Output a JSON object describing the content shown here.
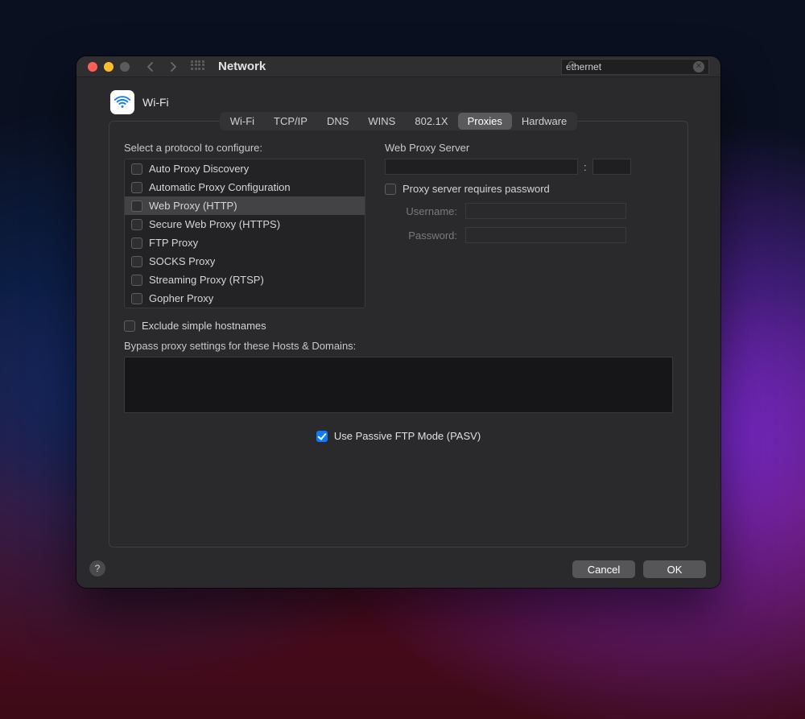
{
  "window": {
    "title": "Network",
    "search_value": "ethernet"
  },
  "interface": {
    "name": "Wi-Fi"
  },
  "tabs": [
    {
      "label": "Wi-Fi"
    },
    {
      "label": "TCP/IP"
    },
    {
      "label": "DNS"
    },
    {
      "label": "WINS"
    },
    {
      "label": "802.1X"
    },
    {
      "label": "Proxies"
    },
    {
      "label": "Hardware"
    }
  ],
  "active_tab": "Proxies",
  "left": {
    "heading": "Select a protocol to configure:",
    "protocols": [
      {
        "label": "Auto Proxy Discovery",
        "checked": false,
        "selected": false
      },
      {
        "label": "Automatic Proxy Configuration",
        "checked": false,
        "selected": false
      },
      {
        "label": "Web Proxy (HTTP)",
        "checked": false,
        "selected": true
      },
      {
        "label": "Secure Web Proxy (HTTPS)",
        "checked": false,
        "selected": false
      },
      {
        "label": "FTP Proxy",
        "checked": false,
        "selected": false
      },
      {
        "label": "SOCKS Proxy",
        "checked": false,
        "selected": false
      },
      {
        "label": "Streaming Proxy (RTSP)",
        "checked": false,
        "selected": false
      },
      {
        "label": "Gopher Proxy",
        "checked": false,
        "selected": false
      }
    ]
  },
  "right": {
    "server_heading": "Web Proxy Server",
    "server_host": "",
    "server_port": "",
    "requires_password_label": "Proxy server requires password",
    "requires_password_checked": false,
    "username_label": "Username:",
    "username_value": "",
    "password_label": "Password:",
    "password_value": ""
  },
  "exclude": {
    "label": "Exclude simple hostnames",
    "checked": false
  },
  "bypass": {
    "label": "Bypass proxy settings for these Hosts & Domains:",
    "value": ""
  },
  "pasv": {
    "label": "Use Passive FTP Mode (PASV)",
    "checked": true
  },
  "buttons": {
    "cancel": "Cancel",
    "ok": "OK"
  },
  "separator": ":"
}
